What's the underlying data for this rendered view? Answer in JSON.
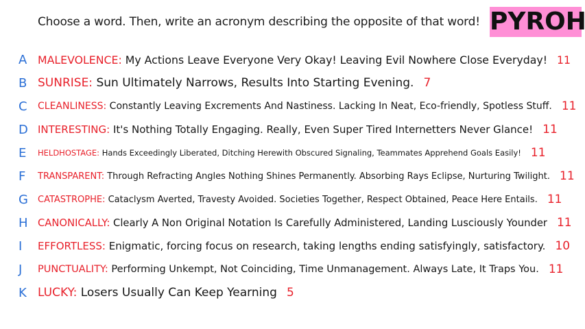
{
  "prompt": "Choose a word. Then, write an acronym describing the opposite of that word!",
  "badge": "PYROHY",
  "colors": {
    "letter": "#2a6fd6",
    "word": "#e8202a",
    "count": "#e8202a",
    "badge_bg": "#ff8fd6"
  },
  "rows": [
    {
      "letter": "A",
      "word": "MALEVOLENCE:",
      "acronym": "My Actions Leave Everyone Very Okay! Leaving Evil Nowhere Close Everyday!",
      "count": "11"
    },
    {
      "letter": "B",
      "word": "SUNRISE:",
      "acronym": "Sun Ultimately Narrows, Results Into Starting Evening.",
      "count": "7"
    },
    {
      "letter": "C",
      "word": "CLEANLINESS:",
      "acronym": "Constantly Leaving Excrements And Nastiness. Lacking In Neat, Eco-friendly, Spotless Stuff.",
      "count": "11"
    },
    {
      "letter": "D",
      "word": "INTERESTING:",
      "acronym": "It's Nothing Totally Engaging. Really, Even Super Tired Internetters Never Glance!",
      "count": "11"
    },
    {
      "letter": "E",
      "word": "HELDHOSTAGE:",
      "acronym": "Hands Exceedingly Liberated, Ditching Herewith Obscured Signaling, Teammates Apprehend Goals Easily!",
      "count": "11"
    },
    {
      "letter": "F",
      "word": "TRANSPARENT:",
      "acronym": "Through Refracting Angles Nothing Shines Permanently. Absorbing Rays Eclipse, Nurturing Twilight.",
      "count": "11"
    },
    {
      "letter": "G",
      "word": "CATASTROPHE:",
      "acronym": "Cataclysm Averted, Travesty Avoided. Societies Together, Respect Obtained, Peace Here Entails.",
      "count": "11"
    },
    {
      "letter": "H",
      "word": "CANONICALLY:",
      "acronym": "Clearly A Non Original Notation Is Carefully Administered, Landing Lusciously Younder",
      "count": "11"
    },
    {
      "letter": "I",
      "word": "EFFORTLESS:",
      "acronym": "Enigmatic, forcing focus on research, taking lengths ending satisfyingly, satisfactory.",
      "count": "10"
    },
    {
      "letter": "J",
      "word": "PUNCTUALITY:",
      "acronym": "Performing Unkempt, Not Coinciding, Time Unmanagement. Always Late, It Traps You.",
      "count": "11"
    },
    {
      "letter": "K",
      "word": "LUCKY:",
      "acronym": "Losers Usually Can Keep Yearning",
      "count": "5"
    }
  ]
}
